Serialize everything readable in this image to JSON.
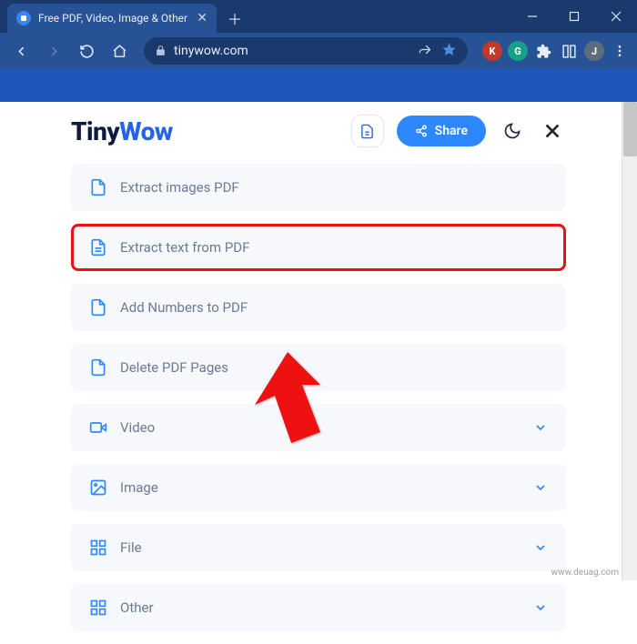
{
  "browser": {
    "tab_title": "Free PDF, Video, Image & Other",
    "url": "tinywow.com",
    "extensions": [
      "K",
      "G",
      "J"
    ]
  },
  "header": {
    "logo_tiny": "Tiny",
    "logo_wow": "Wow",
    "share_label": "Share"
  },
  "menu": {
    "pdf_items": [
      {
        "label": "Extract images PDF"
      },
      {
        "label": "Extract text from PDF",
        "highlighted": true
      },
      {
        "label": "Add Numbers to PDF"
      },
      {
        "label": "Delete PDF Pages"
      }
    ],
    "categories": [
      {
        "label": "Video",
        "icon": "video"
      },
      {
        "label": "Image",
        "icon": "image"
      },
      {
        "label": "File",
        "icon": "grid"
      },
      {
        "label": "Other",
        "icon": "grid"
      }
    ]
  },
  "watermark": "www.deuag.com"
}
